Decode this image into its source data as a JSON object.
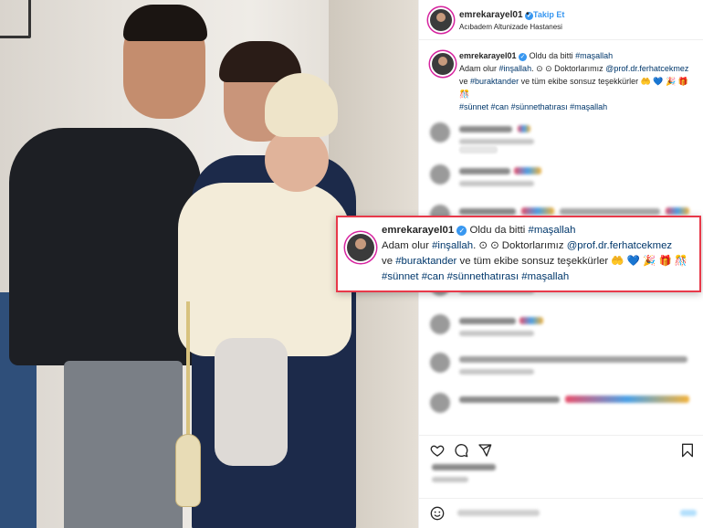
{
  "header": {
    "username": "emrekarayel01",
    "verified_mark": "✓",
    "separator": "•",
    "follow_label": "Takip Et",
    "location": "Acıbadem Altunizade Hastanesi"
  },
  "caption": {
    "username": "emrekarayel01",
    "verified_mark": "✓",
    "t1": "Oldu da bitti",
    "tag_masallah": "#maşallah",
    "t2": "Adam olur",
    "tag_insallah": "#inşallah",
    "t3": ". ⊙ ⊙ Doktorlarımız",
    "mention_prof": "@prof.dr.ferhatcekmez",
    "t4": "ve",
    "tag_buraktander": "#buraktander",
    "t5": "ve tüm ekibe sonsuz teşekkürler",
    "emojis": "🤲 💙 🎉 🎁 🎊",
    "tag_sunnet": "#sünnet",
    "tag_can": "#can",
    "tag_sunnethatirasi": "#sünnethatırası",
    "tag_masallah2": "#maşallah"
  },
  "icons": {
    "like": "heart-icon",
    "comment": "comment-icon",
    "share": "share-icon",
    "save": "bookmark-icon"
  },
  "colors": {
    "accent": "#3897f0",
    "hashtag": "#00376b",
    "callout_border": "#e8394a"
  }
}
